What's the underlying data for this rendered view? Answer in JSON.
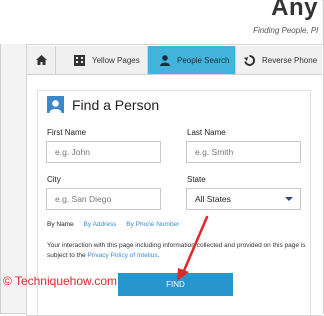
{
  "header": {
    "logo": "Any",
    "tagline": "Finding People, Pl"
  },
  "tabs": [
    {
      "label": "",
      "icon": "home-icon"
    },
    {
      "label": "Yellow Pages",
      "icon": "building-icon"
    },
    {
      "label": "People Search",
      "icon": "person-icon",
      "active": true
    },
    {
      "label": "Reverse Phone",
      "icon": "phone-icon"
    }
  ],
  "form": {
    "title": "Find a Person",
    "first_name": {
      "label": "First Name",
      "placeholder": "e.g. John"
    },
    "last_name": {
      "label": "Last Name",
      "placeholder": "e.g. Smith"
    },
    "city": {
      "label": "City",
      "placeholder": "e.g. San Diego"
    },
    "state": {
      "label": "State",
      "value": "All States"
    },
    "search_by": [
      "By Name",
      "By Address",
      "By Phone Number"
    ],
    "disclaimer_text": "Your interaction with this page including information collected and provided on this page is subject to the ",
    "disclaimer_link": "Privacy Policy of Intelius",
    "disclaimer_end": ".",
    "submit_label": "FIND"
  },
  "watermark": "© Techniquehow.com",
  "colors": {
    "active_tab": "#42b4dc",
    "find_button": "#2796cc",
    "link": "#3a8bd0",
    "watermark": "#e02828",
    "arrow": "#e02828",
    "badge": "#3b87c7"
  }
}
